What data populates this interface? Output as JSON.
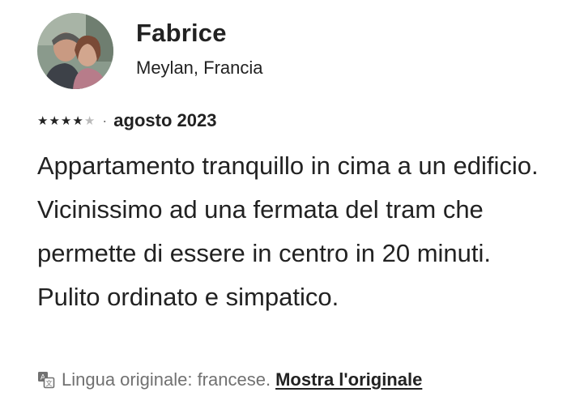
{
  "reviewer": {
    "name": "Fabrice",
    "location": "Meylan, Francia"
  },
  "rating": {
    "value": 4,
    "max": 5
  },
  "date": "agosto 2023",
  "review_text": "Appartamento tranquillo in cima a un edificio. Vicinissimo ad una fermata del tram che permette di essere in centro in 20 minuti. Pulito ordinato e simpatico.",
  "translation": {
    "icon": "translate-icon",
    "note": "Lingua originale: francese.",
    "link_label": "Mostra l'originale"
  },
  "colors": {
    "text": "#222222",
    "secondary": "#717171",
    "star_empty": "#bbbbbb"
  }
}
